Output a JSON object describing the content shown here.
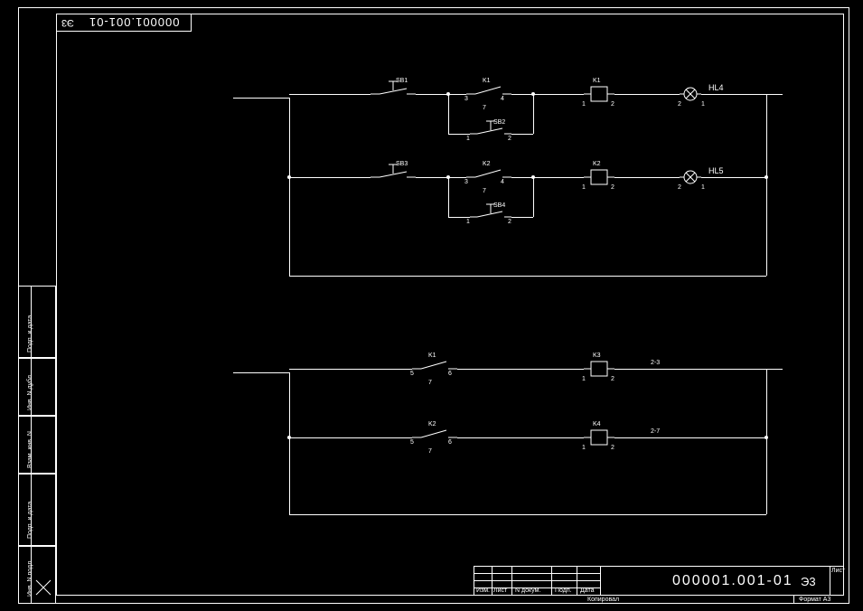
{
  "drawing_number_flip": "000001.001-01",
  "type_code_flip": "Э3",
  "drawing_number": "000001.001-01",
  "type_code": "Э3",
  "titleblock": {
    "izm": "Изм.",
    "list": "Лист",
    "ndok": "N докум.",
    "podp": "Подп.",
    "data": "Дата",
    "kopiroval": "Копировал",
    "format": "Формат A3",
    "list_corner": "Лист"
  },
  "sidebar": {
    "inv_n_podl": "Инв. N подл.",
    "podp_i_data1": "Подп. и дата.",
    "vzam_inv_n": "Взам. инв. N",
    "inv_n_dubl": "Инв. N дубл.",
    "podp_i_data2": "Подп. и дата."
  },
  "schematic": {
    "sb1": "SB1",
    "sb2": "SB2",
    "sb3": "SB3",
    "sb4": "SB4",
    "k1": "K1",
    "k2": "K2",
    "k1coil": "K1",
    "k2coil": "K2",
    "k3coil": "K3",
    "k4coil": "K4",
    "hl4": "HL4",
    "hl5": "HL5",
    "net23": "2-3",
    "net27": "2-7",
    "pin1": "1",
    "pin2": "2",
    "pin3": "3",
    "pin4": "4",
    "pin5": "5",
    "pin6": "6",
    "pin7": "7"
  }
}
